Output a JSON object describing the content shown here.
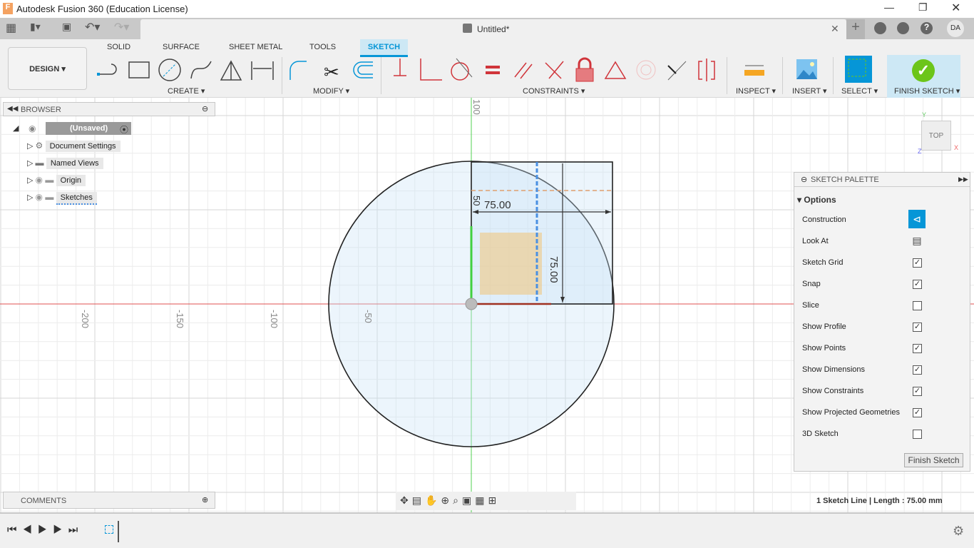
{
  "window": {
    "title": "Autodesk Fusion 360 (Education License)",
    "doc_title": "Untitled*",
    "user_initials": "DA"
  },
  "toolbar": {
    "workspace": "DESIGN ▾",
    "tabs": [
      "SOLID",
      "SURFACE",
      "SHEET METAL",
      "TOOLS",
      "SKETCH"
    ],
    "active_tab": "SKETCH",
    "groups": {
      "create": "CREATE ▾",
      "modify": "MODIFY ▾",
      "constraints": "CONSTRAINTS ▾",
      "inspect": "INSPECT ▾",
      "insert": "INSERT ▾",
      "select": "SELECT ▾",
      "finish": "FINISH SKETCH ▾"
    }
  },
  "browser": {
    "title": "BROWSER",
    "root": "(Unsaved)",
    "items": [
      "Document Settings",
      "Named Views",
      "Origin",
      "Sketches"
    ]
  },
  "comments": {
    "title": "COMMENTS"
  },
  "viewcube": {
    "face": "TOP",
    "x": "X",
    "y": "Y",
    "z": "Z"
  },
  "canvas": {
    "axis_labels": [
      "-200",
      "-150",
      "-100",
      "-50",
      "100"
    ],
    "dimensions": [
      "75.00",
      "75.00",
      "50"
    ]
  },
  "palette": {
    "title": "SKETCH PALETTE",
    "section": "Options",
    "rows": [
      {
        "label": "Construction",
        "type": "button"
      },
      {
        "label": "Look At",
        "type": "button"
      },
      {
        "label": "Sketch Grid",
        "checked": true
      },
      {
        "label": "Snap",
        "checked": true
      },
      {
        "label": "Slice",
        "checked": false
      },
      {
        "label": "Show Profile",
        "checked": true
      },
      {
        "label": "Show Points",
        "checked": true
      },
      {
        "label": "Show Dimensions",
        "checked": true
      },
      {
        "label": "Show Constraints",
        "checked": true
      },
      {
        "label": "Show Projected Geometries",
        "checked": true
      },
      {
        "label": "3D Sketch",
        "checked": false
      }
    ],
    "finish_button": "Finish Sketch"
  },
  "status": {
    "selection": "1 Sketch Line | Length : 75.00 mm"
  },
  "colors": {
    "accent": "#0696d7",
    "finish_green": "#6cc519",
    "constraint_red": "#d0343a"
  }
}
